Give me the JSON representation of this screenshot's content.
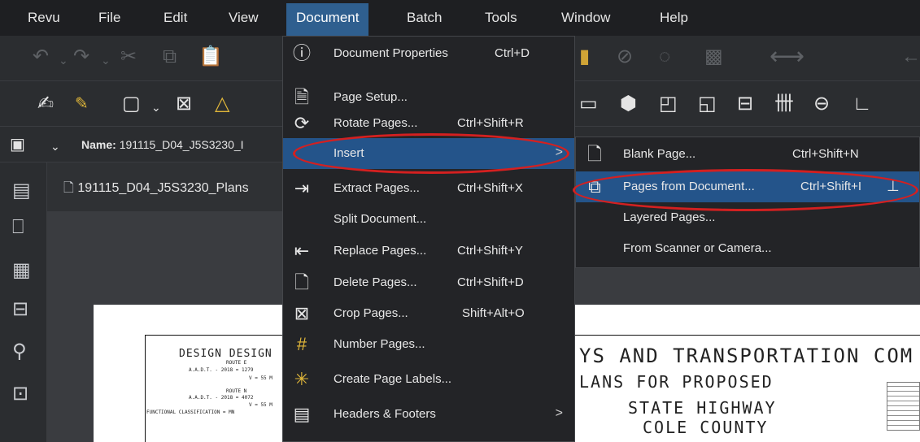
{
  "menubar": {
    "items": [
      "Revu",
      "File",
      "Edit",
      "View",
      "Document",
      "Batch",
      "Tools",
      "Window",
      "Help"
    ]
  },
  "toolbar": {
    "name_label": "Name:",
    "name_value": "191115_D04_J5S3230_I"
  },
  "file_tab": {
    "label": "191115_D04_J5S3230_Plans"
  },
  "document_menu": {
    "items": [
      {
        "label": "Document Properties",
        "shortcut": "Ctrl+D",
        "icon": "info-icon"
      },
      {
        "label": "Page Setup...",
        "shortcut": "",
        "icon": "page-setup-icon"
      },
      {
        "label": "Rotate Pages...",
        "shortcut": "Ctrl+Shift+R",
        "icon": "rotate-pages-icon"
      },
      {
        "label": "Insert",
        "shortcut": "",
        "icon": "",
        "submenu_arrow": ">"
      },
      {
        "label": "Extract Pages...",
        "shortcut": "Ctrl+Shift+X",
        "icon": "extract-pages-icon"
      },
      {
        "label": "Split Document...",
        "shortcut": "",
        "icon": ""
      },
      {
        "label": "Replace Pages...",
        "shortcut": "Ctrl+Shift+Y",
        "icon": "replace-pages-icon"
      },
      {
        "label": "Delete Pages...",
        "shortcut": "Ctrl+Shift+D",
        "icon": "delete-pages-icon"
      },
      {
        "label": "Crop Pages...",
        "shortcut": "Shift+Alt+O",
        "icon": "crop-icon"
      },
      {
        "label": "Number Pages...",
        "shortcut": "",
        "icon": "number-pages-icon"
      },
      {
        "label": "Create Page Labels...",
        "shortcut": "",
        "icon": "page-labels-icon"
      },
      {
        "label": "Headers & Footers",
        "shortcut": "",
        "icon": "headers-footers-icon",
        "submenu_arrow": ">"
      }
    ]
  },
  "insert_submenu": {
    "items": [
      {
        "label": "Blank Page...",
        "shortcut": "Ctrl+Shift+N",
        "icon": "blank-page-icon"
      },
      {
        "label": "Pages from Document...",
        "shortcut": "Ctrl+Shift+I",
        "icon": "pages-from-document-icon"
      },
      {
        "label": "Layered Pages...",
        "shortcut": "",
        "icon": ""
      },
      {
        "label": "From Scanner or Camera...",
        "shortcut": "",
        "icon": ""
      }
    ]
  },
  "drawing": {
    "design_title": "DESIGN DESIGN",
    "route_e": "ROUTE E",
    "aadt_e": "A.A.D.T. - 2018 = 1279",
    "v_e": "V = 55 M",
    "route_n": "ROUTE N",
    "aadt_n": "A.A.D.T. - 2018 = 4072",
    "v_n": "V = 55 M",
    "func_class": "FUNCTIONAL CLASSIFICATION = MN",
    "line1": "YS AND TRANSPORTATION COM",
    "line2": "LANS FOR PROPOSED",
    "line3": "STATE HIGHWAY",
    "line4": "COLE COUNTY"
  }
}
